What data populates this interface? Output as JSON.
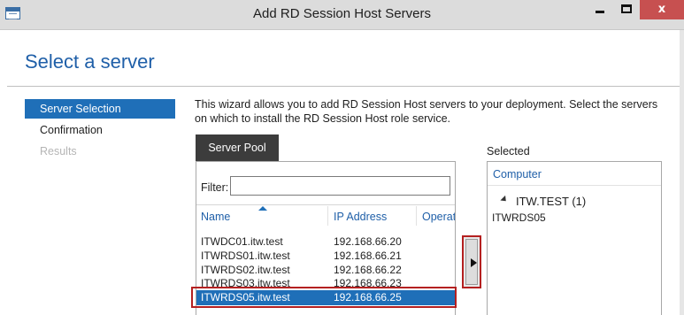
{
  "window": {
    "title": "Add RD Session Host Servers",
    "close_label": "x"
  },
  "page": {
    "heading": "Select a server"
  },
  "nav": {
    "items": [
      {
        "label": "Server Selection",
        "state": "active"
      },
      {
        "label": "Confirmation",
        "state": "normal"
      },
      {
        "label": "Results",
        "state": "disabled"
      }
    ]
  },
  "description": "This wizard allows you to add RD Session Host servers to your deployment. Select the servers on which to install the RD Session Host role service.",
  "server_pool": {
    "tab_label": "Server Pool",
    "filter_label": "Filter:",
    "filter_value": "",
    "columns": [
      "Name",
      "IP Address",
      "Operat"
    ],
    "rows": [
      {
        "name": "ITWDC01.itw.test",
        "ip": "192.168.66.20"
      },
      {
        "name": "ITWRDS01.itw.test",
        "ip": "192.168.66.21"
      },
      {
        "name": "ITWRDS02.itw.test",
        "ip": "192.168.66.22"
      },
      {
        "name": "ITWRDS03.itw.test",
        "ip": "192.168.66.23"
      },
      {
        "name": "ITWRDS05.itw.test",
        "ip": "192.168.66.25",
        "selected": true
      }
    ]
  },
  "selected": {
    "label": "Selected",
    "column": "Computer",
    "group": "ITW.TEST (1)",
    "items": [
      "ITWRDS05"
    ]
  },
  "colors": {
    "accent": "#1f6fb8",
    "heading": "#1f5fa8",
    "highlight_box": "#b42020",
    "close_button": "#c75050"
  }
}
